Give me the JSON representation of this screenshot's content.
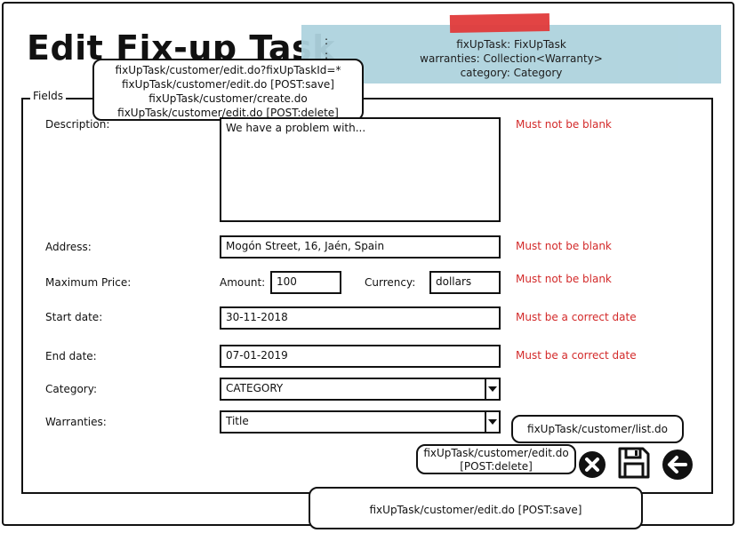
{
  "page": {
    "title": "Edit Fix-up Task"
  },
  "model_note": {
    "dots": [
      ":",
      ":"
    ],
    "lines": [
      "fixUpTask: FixUpTask",
      "warranties: Collection<Warranty>",
      "category: Category"
    ]
  },
  "urls_bubble": {
    "lines": [
      "fixUpTask/customer/edit.do?fixUpTaskId=*",
      "fixUpTask/customer/edit.do [POST:save]",
      "fixUpTask/customer/create.do",
      "fixUpTask/customer/edit.do [POST:delete]"
    ]
  },
  "fieldset": {
    "legend": "Fields"
  },
  "form": {
    "description": {
      "label": "Description:",
      "value": "We have a problem with...",
      "error": "Must not be blank"
    },
    "address": {
      "label": "Address:",
      "value": "Mogón Street, 16, Jaén, Spain",
      "error": "Must not be blank"
    },
    "max_price": {
      "label": "Maximum Price:",
      "amount_label": "Amount:",
      "amount_value": "100",
      "currency_label": "Currency:",
      "currency_value": "dollars",
      "error": "Must not be blank"
    },
    "start_date": {
      "label": "Start date:",
      "value": "30-11-2018",
      "error": "Must be a correct date"
    },
    "end_date": {
      "label": "End date:",
      "value": "07-01-2019",
      "error": "Must be a correct date"
    },
    "category": {
      "label": "Category:",
      "value": "CATEGORY"
    },
    "warranties": {
      "label": "Warranties:",
      "value": "Title"
    }
  },
  "actions": {
    "list_bubble": "fixUpTask/customer/list.do",
    "delete_bubble": [
      "fixUpTask/customer/edit.do",
      "[POST:delete]"
    ],
    "save_bubble": "fixUpTask/customer/edit.do [POST:save]",
    "icons": [
      "delete-icon",
      "save-icon",
      "back-arrow-icon"
    ]
  }
}
